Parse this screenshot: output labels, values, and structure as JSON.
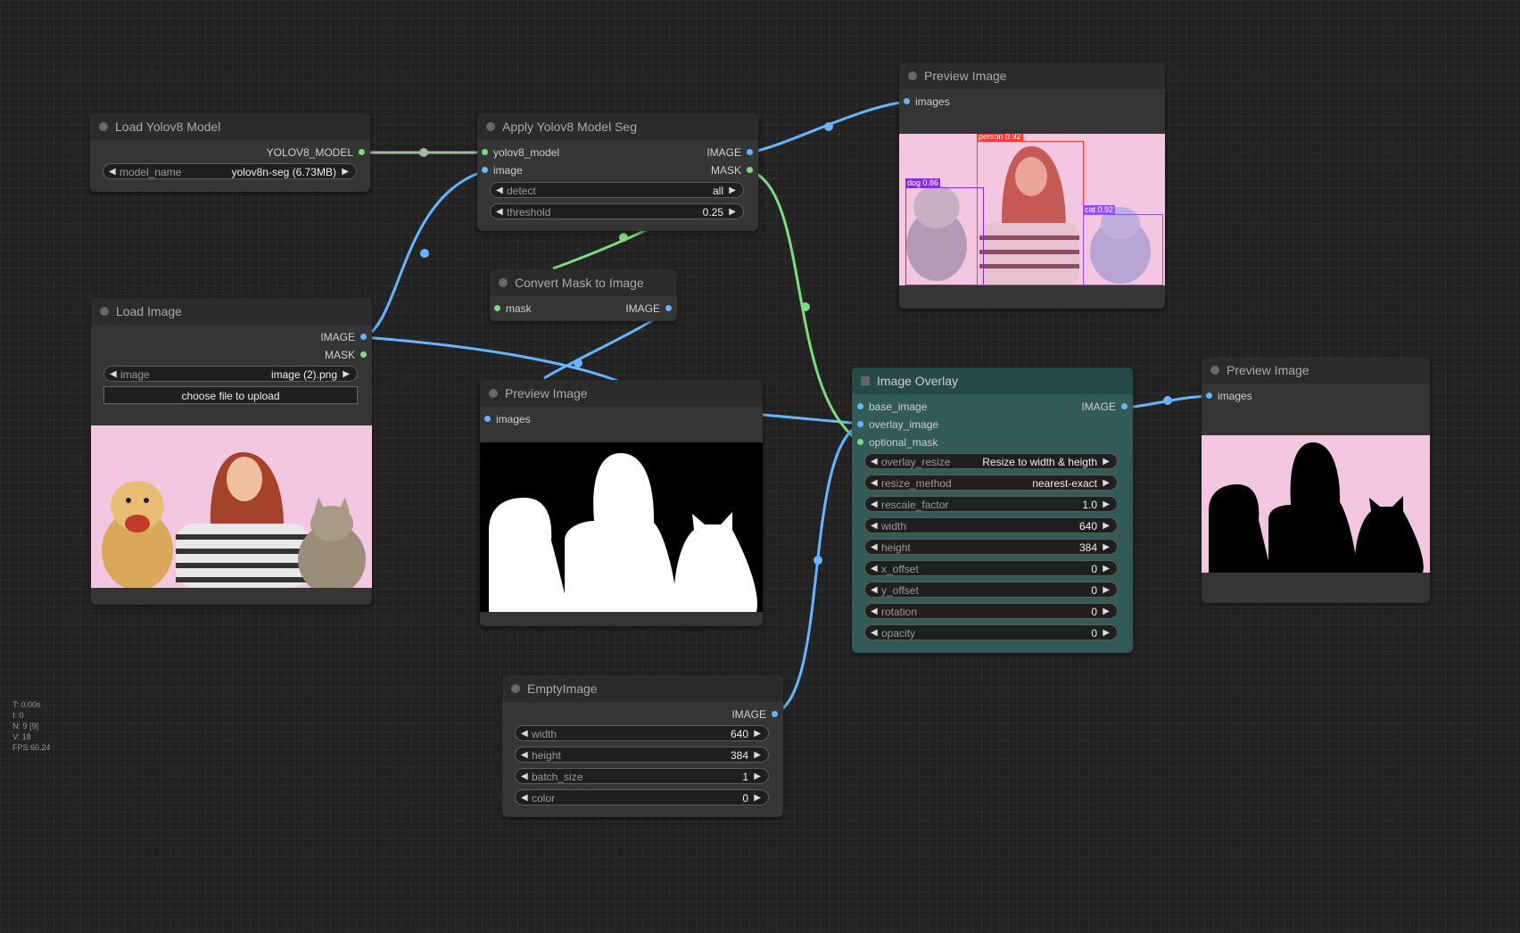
{
  "nodes": {
    "load_yolo": {
      "title": "Load Yolov8 Model",
      "output_model": "YOLOV8_MODEL",
      "model_name": {
        "label": "model_name",
        "value": "yolov8n-seg (6.73MB)"
      }
    },
    "apply_yolo": {
      "title": "Apply Yolov8 Model Seg",
      "inputs": [
        "yolov8_model",
        "image"
      ],
      "outputs": [
        "IMAGE",
        "MASK"
      ],
      "detect": {
        "label": "detect",
        "value": "all"
      },
      "threshold": {
        "label": "threshold",
        "value": "0.25"
      }
    },
    "convert_mask": {
      "title": "Convert Mask to Image",
      "input": "mask",
      "output": "IMAGE"
    },
    "load_image": {
      "title": "Load Image",
      "outputs": [
        "IMAGE",
        "MASK"
      ],
      "image": {
        "label": "image",
        "value": "image (2).png"
      },
      "upload_button": "choose file to upload"
    },
    "preview_top": {
      "title": "Preview Image",
      "input": "images",
      "detections": [
        {
          "label": "dog 0.86",
          "color": "#8a2be2"
        },
        {
          "label": "person 0.92",
          "color": "#ff3b3b"
        },
        {
          "label": "cat 0.92",
          "color": "#9b4dff"
        }
      ]
    },
    "preview_mask": {
      "title": "Preview Image",
      "input": "images"
    },
    "image_overlay": {
      "title": "Image Overlay",
      "inputs": [
        "base_image",
        "overlay_image",
        "optional_mask"
      ],
      "output": "IMAGE",
      "widgets": [
        {
          "label": "overlay_resize",
          "value": "Resize to width & heigth"
        },
        {
          "label": "resize_method",
          "value": "nearest-exact"
        },
        {
          "label": "rescale_factor",
          "value": "1.0"
        },
        {
          "label": "width",
          "value": "640"
        },
        {
          "label": "height",
          "value": "384"
        },
        {
          "label": "x_offset",
          "value": "0"
        },
        {
          "label": "y_offset",
          "value": "0"
        },
        {
          "label": "rotation",
          "value": "0"
        },
        {
          "label": "opacity",
          "value": "0"
        }
      ]
    },
    "preview_right": {
      "title": "Preview Image",
      "input": "images"
    },
    "empty_image": {
      "title": "EmptyImage",
      "output": "IMAGE",
      "widgets": [
        {
          "label": "width",
          "value": "640"
        },
        {
          "label": "height",
          "value": "384"
        },
        {
          "label": "batch_size",
          "value": "1"
        },
        {
          "label": "color",
          "value": "0"
        }
      ]
    }
  },
  "stats": [
    "T: 0.00s",
    "I: 0",
    "N: 9 [9]",
    "V: 18",
    "FPS:60.24"
  ],
  "colors": {
    "image_link": "#65b5ff",
    "mask_link": "#7fdb7f",
    "model_link": "#a3b9a3",
    "pink_background": "#f3c6e1",
    "teal_node": "#325a57"
  }
}
